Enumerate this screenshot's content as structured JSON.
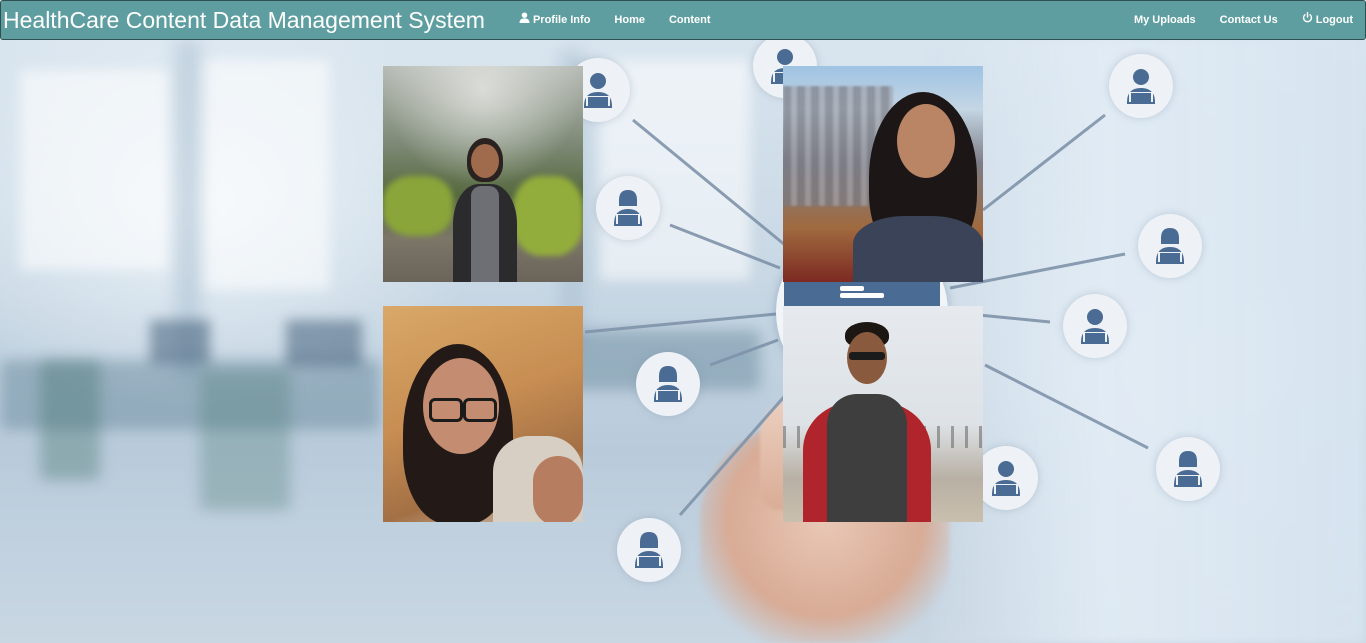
{
  "navbar": {
    "brand": "HealthCare Content Data Management System",
    "left_links": [
      {
        "label": "Profile Info",
        "icon": "user-icon"
      },
      {
        "label": "Home"
      },
      {
        "label": "Content"
      }
    ],
    "right_links": [
      {
        "label": "My Uploads"
      },
      {
        "label": "Contact Us"
      },
      {
        "label": "Logout",
        "icon": "power-icon"
      }
    ]
  },
  "team_photos": [
    {
      "name": "team-photo-1"
    },
    {
      "name": "team-photo-2"
    },
    {
      "name": "team-photo-3"
    },
    {
      "name": "team-photo-4"
    }
  ],
  "colors": {
    "navbar": "#5f9ea0",
    "navbar_border": "#2f4f4f",
    "network_icon": "#4a6b94",
    "network_line": "#7f93aa"
  }
}
